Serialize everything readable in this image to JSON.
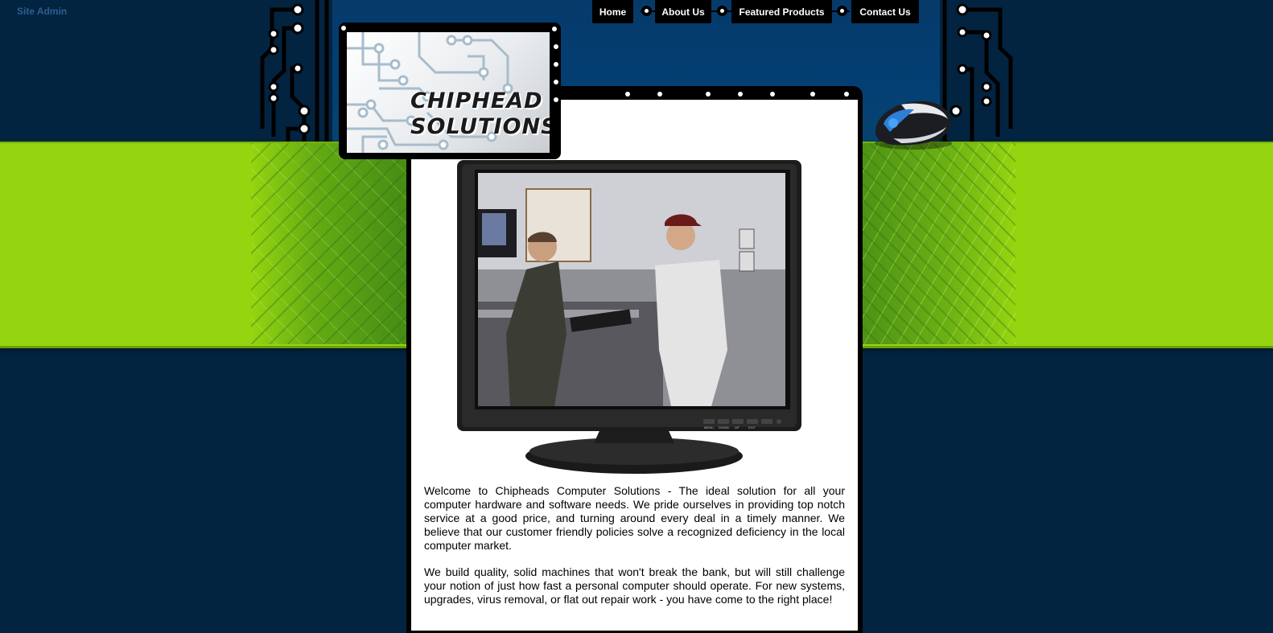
{
  "admin_link": "Site Admin",
  "nav": {
    "items": [
      {
        "label": "Home"
      },
      {
        "label": "About Us"
      },
      {
        "label": "Featured Products"
      },
      {
        "label": "Contact Us"
      }
    ]
  },
  "logo": {
    "line1": "CHIPHEAD",
    "line2": "SOLUTIONS"
  },
  "hero": {
    "monitor_buttons": [
      "MENU",
      "DOWN",
      "UP",
      "EXIT"
    ]
  },
  "content": {
    "paragraphs": [
      "Welcome to Chipheads Computer Solutions - The ideal solution for all your computer hardware and software needs. We pride ourselves in providing top notch service at a good price, and turning around every deal in a timely manner. We believe that our customer friendly policies solve a recognized deficiency in the local computer market.",
      "We build quality, solid machines that won't break the bank, but will still challenge your notion of just how fast a personal computer should operate. For new systems, upgrades, virus removal, or flat out repair work - you have come to the right place!"
    ]
  },
  "colors": {
    "page_background": "#032440",
    "top_panel": "#033f73",
    "accent_green": "#95d510",
    "nav_background": "#000000",
    "nav_text": "#ffffff",
    "admin_link": "#2b5f93"
  }
}
